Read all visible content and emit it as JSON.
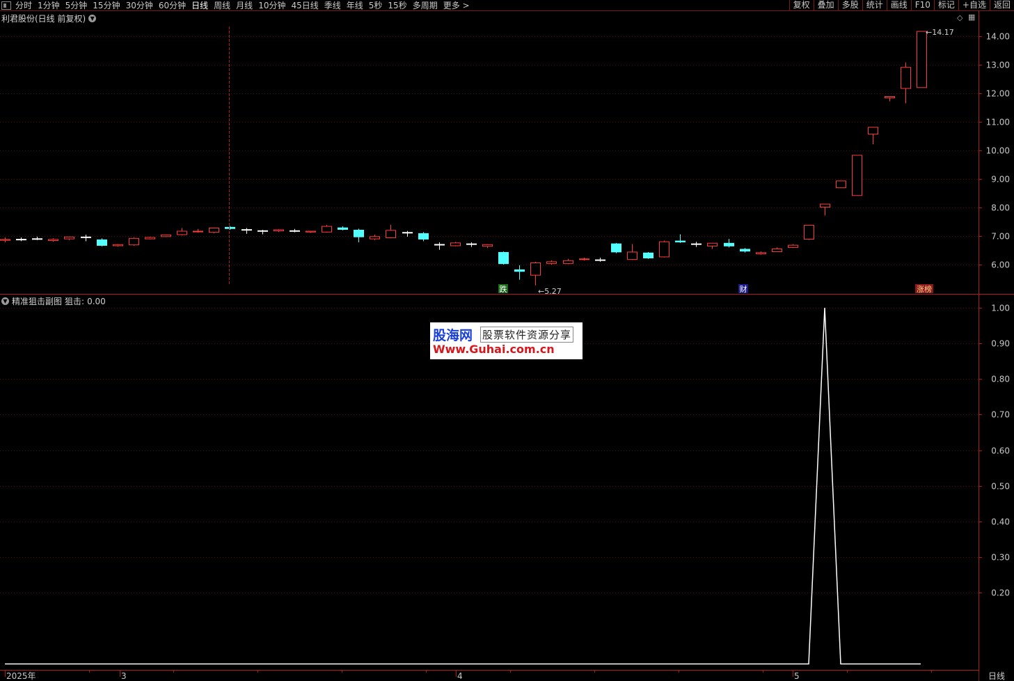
{
  "toolbar": {
    "periods": [
      "分时",
      "1分钟",
      "5分钟",
      "15分钟",
      "30分钟",
      "60分钟",
      "日线",
      "周线",
      "月线",
      "10分钟",
      "45日线",
      "季线",
      "年线",
      "5秒",
      "15秒",
      "多周期",
      "更多 >"
    ],
    "active_period": "日线",
    "right_tools": [
      "复权",
      "叠加",
      "多股",
      "统计",
      "画线",
      "F10",
      "标记",
      "+自选",
      "返回"
    ]
  },
  "main_chart": {
    "title": "利君股份(日线 前复权)",
    "high_label": "14.17",
    "low_label": "5.27",
    "event_markers": [
      {
        "text": "跌",
        "bg": "#1a6a1a",
        "fg": "#ffffff"
      },
      {
        "text": "财",
        "bg": "#1a1a8a",
        "fg": "#ffffff"
      },
      {
        "text": "涨榜",
        "bg": "#8a1a1a",
        "fg": "#ffd08a"
      }
    ]
  },
  "sub_chart": {
    "title": "精准狙击副图",
    "series_label": "狙击:",
    "series_value": "0.00"
  },
  "x_axis": {
    "labels": [
      "2025年",
      "3",
      "4",
      "5"
    ]
  },
  "period_indicator": "日线",
  "watermark": {
    "brand": "股海网",
    "tagline": "股票软件资源分享",
    "url": "Www.Guhai.com.cn"
  },
  "colors": {
    "up": "#ff3b3b",
    "down": "#54ffff",
    "flat": "#ffffff",
    "axis": "#b01c1c",
    "grid": "#5a1010"
  },
  "chart_data": [
    {
      "type": "candlestick",
      "title": "利君股份(日线 前复权)",
      "ylim": [
        5.0,
        14.4
      ],
      "y_ticks": [
        "6.00",
        "7.00",
        "8.00",
        "9.00",
        "10.00",
        "11.00",
        "12.00",
        "13.00",
        "14.00"
      ],
      "candles": [
        {
          "o": 6.85,
          "h": 6.95,
          "l": 6.78,
          "c": 6.88,
          "d": "up"
        },
        {
          "o": 6.9,
          "h": 6.95,
          "l": 6.82,
          "c": 6.88,
          "d": "flat"
        },
        {
          "o": 6.92,
          "h": 6.98,
          "l": 6.86,
          "c": 6.9,
          "d": "flat"
        },
        {
          "o": 6.84,
          "h": 6.92,
          "l": 6.8,
          "c": 6.88,
          "d": "up"
        },
        {
          "o": 6.9,
          "h": 6.98,
          "l": 6.86,
          "c": 6.97,
          "d": "up"
        },
        {
          "o": 6.98,
          "h": 7.05,
          "l": 6.82,
          "c": 6.94,
          "d": "flat"
        },
        {
          "o": 6.88,
          "h": 6.92,
          "l": 6.64,
          "c": 6.66,
          "d": "down"
        },
        {
          "o": 6.66,
          "h": 6.72,
          "l": 6.63,
          "c": 6.7,
          "d": "up"
        },
        {
          "o": 6.69,
          "h": 6.95,
          "l": 6.66,
          "c": 6.92,
          "d": "up"
        },
        {
          "o": 6.9,
          "h": 6.98,
          "l": 6.88,
          "c": 6.95,
          "d": "up"
        },
        {
          "o": 6.98,
          "h": 7.05,
          "l": 6.96,
          "c": 7.04,
          "d": "up"
        },
        {
          "o": 7.05,
          "h": 7.28,
          "l": 7.02,
          "c": 7.17,
          "d": "up"
        },
        {
          "o": 7.15,
          "h": 7.25,
          "l": 7.12,
          "c": 7.17,
          "d": "up"
        },
        {
          "o": 7.13,
          "h": 7.3,
          "l": 7.1,
          "c": 7.28,
          "d": "up"
        },
        {
          "o": 7.32,
          "h": 7.35,
          "l": 7.22,
          "c": 7.25,
          "d": "down"
        },
        {
          "o": 7.24,
          "h": 7.28,
          "l": 7.08,
          "c": 7.2,
          "d": "flat"
        },
        {
          "o": 7.2,
          "h": 7.22,
          "l": 7.06,
          "c": 7.18,
          "d": "flat"
        },
        {
          "o": 7.18,
          "h": 7.24,
          "l": 7.14,
          "c": 7.22,
          "d": "up"
        },
        {
          "o": 7.2,
          "h": 7.25,
          "l": 7.13,
          "c": 7.18,
          "d": "flat"
        },
        {
          "o": 7.14,
          "h": 7.18,
          "l": 7.11,
          "c": 7.17,
          "d": "up"
        },
        {
          "o": 7.14,
          "h": 7.39,
          "l": 7.12,
          "c": 7.34,
          "d": "up"
        },
        {
          "o": 7.3,
          "h": 7.34,
          "l": 7.2,
          "c": 7.22,
          "d": "down"
        },
        {
          "o": 7.22,
          "h": 7.26,
          "l": 6.78,
          "c": 6.96,
          "d": "down"
        },
        {
          "o": 6.9,
          "h": 7.05,
          "l": 6.86,
          "c": 6.98,
          "d": "up"
        },
        {
          "o": 6.94,
          "h": 7.4,
          "l": 6.92,
          "c": 7.2,
          "d": "up"
        },
        {
          "o": 7.14,
          "h": 7.18,
          "l": 6.98,
          "c": 7.1,
          "d": "flat"
        },
        {
          "o": 7.1,
          "h": 7.14,
          "l": 6.82,
          "c": 6.88,
          "d": "down"
        },
        {
          "o": 6.72,
          "h": 6.78,
          "l": 6.52,
          "c": 6.7,
          "d": "flat"
        },
        {
          "o": 6.66,
          "h": 6.8,
          "l": 6.64,
          "c": 6.76,
          "d": "up"
        },
        {
          "o": 6.74,
          "h": 6.78,
          "l": 6.62,
          "c": 6.72,
          "d": "flat"
        },
        {
          "o": 6.64,
          "h": 6.72,
          "l": 6.58,
          "c": 6.7,
          "d": "up"
        },
        {
          "o": 6.44,
          "h": 6.46,
          "l": 6.0,
          "c": 6.02,
          "d": "down"
        },
        {
          "o": 5.83,
          "h": 5.98,
          "l": 5.47,
          "c": 5.75,
          "d": "down"
        },
        {
          "o": 5.63,
          "h": 6.1,
          "l": 5.27,
          "c": 6.06,
          "d": "up"
        },
        {
          "o": 6.04,
          "h": 6.15,
          "l": 6.0,
          "c": 6.1,
          "d": "up"
        },
        {
          "o": 6.04,
          "h": 6.2,
          "l": 6.02,
          "c": 6.14,
          "d": "up"
        },
        {
          "o": 6.18,
          "h": 6.24,
          "l": 6.14,
          "c": 6.2,
          "d": "up"
        },
        {
          "o": 6.18,
          "h": 6.24,
          "l": 6.1,
          "c": 6.18,
          "d": "flat"
        },
        {
          "o": 6.74,
          "h": 6.76,
          "l": 6.4,
          "c": 6.43,
          "d": "down"
        },
        {
          "o": 6.18,
          "h": 6.72,
          "l": 6.16,
          "c": 6.44,
          "d": "up"
        },
        {
          "o": 6.42,
          "h": 6.44,
          "l": 6.2,
          "c": 6.22,
          "d": "down"
        },
        {
          "o": 6.27,
          "h": 6.84,
          "l": 6.25,
          "c": 6.8,
          "d": "up"
        },
        {
          "o": 6.84,
          "h": 7.06,
          "l": 6.76,
          "c": 6.78,
          "d": "down"
        },
        {
          "o": 6.72,
          "h": 6.8,
          "l": 6.62,
          "c": 6.74,
          "d": "flat"
        },
        {
          "o": 6.65,
          "h": 6.76,
          "l": 6.55,
          "c": 6.75,
          "d": "up"
        },
        {
          "o": 6.76,
          "h": 6.9,
          "l": 6.6,
          "c": 6.64,
          "d": "down"
        },
        {
          "o": 6.55,
          "h": 6.58,
          "l": 6.42,
          "c": 6.46,
          "d": "down"
        },
        {
          "o": 6.38,
          "h": 6.46,
          "l": 6.35,
          "c": 6.42,
          "d": "up"
        },
        {
          "o": 6.45,
          "h": 6.6,
          "l": 6.44,
          "c": 6.55,
          "d": "up"
        },
        {
          "o": 6.6,
          "h": 6.72,
          "l": 6.58,
          "c": 6.68,
          "d": "up"
        },
        {
          "o": 6.89,
          "h": 7.38,
          "l": 6.87,
          "c": 7.38,
          "d": "up"
        },
        {
          "o": 8.01,
          "h": 8.12,
          "l": 7.72,
          "c": 8.12,
          "d": "up"
        },
        {
          "o": 8.69,
          "h": 8.93,
          "l": 8.69,
          "c": 8.93,
          "d": "up"
        },
        {
          "o": 8.42,
          "h": 9.83,
          "l": 8.42,
          "c": 9.83,
          "d": "up"
        },
        {
          "o": 10.57,
          "h": 10.81,
          "l": 10.22,
          "c": 10.81,
          "d": "up"
        },
        {
          "o": 11.84,
          "h": 11.89,
          "l": 11.72,
          "c": 11.89,
          "d": "up"
        },
        {
          "o": 12.17,
          "h": 13.08,
          "l": 11.65,
          "c": 12.91,
          "d": "up"
        },
        {
          "o": 12.2,
          "h": 14.17,
          "l": 12.2,
          "c": 14.17,
          "d": "up"
        }
      ]
    },
    {
      "type": "line",
      "title": "精准狙击副图",
      "series": [
        {
          "name": "狙击",
          "values": [
            0,
            0,
            0,
            0,
            0,
            0,
            0,
            0,
            0,
            0,
            0,
            0,
            0,
            0,
            0,
            0,
            0,
            0,
            0,
            0,
            0,
            0,
            0,
            0,
            0,
            0,
            0,
            0,
            0,
            0,
            0,
            0,
            0,
            0,
            0,
            0,
            0,
            0,
            0,
            0,
            0,
            0,
            0,
            0,
            0,
            0,
            0,
            0,
            0,
            0,
            1,
            0,
            0,
            0,
            0,
            0,
            0,
            0
          ]
        }
      ],
      "ylim": [
        0,
        1.02
      ],
      "y_ticks": [
        "0.20",
        "0.30",
        "0.40",
        "0.50",
        "0.60",
        "0.70",
        "0.80",
        "0.90",
        "1.00"
      ]
    }
  ]
}
